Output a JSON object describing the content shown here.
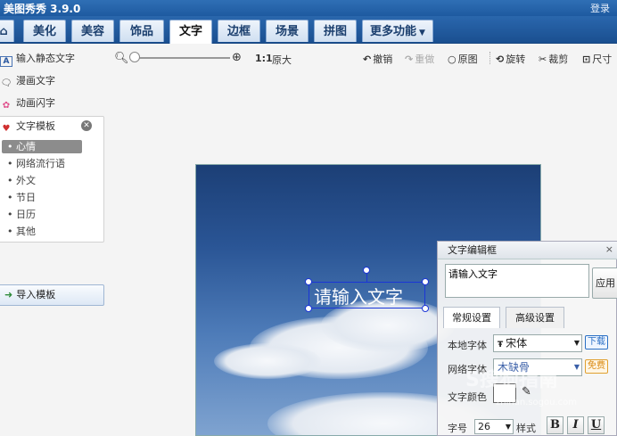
{
  "app": {
    "title": "美图秀秀 3.9.0",
    "login": "登录"
  },
  "tabs": [
    {
      "label": "美化"
    },
    {
      "label": "美容"
    },
    {
      "label": "饰品"
    },
    {
      "label": "文字"
    },
    {
      "label": "边框"
    },
    {
      "label": "场景"
    },
    {
      "label": "拼图"
    },
    {
      "label": "更多功能"
    }
  ],
  "active_tab": "文字",
  "toolbar": {
    "zoom_ratio": "1:1",
    "original_size": "原大",
    "undo": "撤销",
    "redo": "重做",
    "original": "原图",
    "rotate": "旋转",
    "crop": "裁剪",
    "resize": "尺寸"
  },
  "sidebar": {
    "items": [
      {
        "label": "输入静态文字",
        "icon": "A"
      },
      {
        "label": "漫画文字",
        "icon": "speech-icon"
      },
      {
        "label": "动画闪字",
        "icon": "flash-icon"
      }
    ],
    "template_header": "文字模板",
    "template_categories": [
      "心情",
      "网络流行语",
      "外文",
      "节日",
      "日历",
      "其他"
    ],
    "selected_category": "心情",
    "import_button": "导入模板"
  },
  "canvas": {
    "text": "请输入文字"
  },
  "dialog": {
    "title": "文字编辑框",
    "close": "×",
    "input_value": "请输入文字",
    "apply": "应用",
    "tab_basic": "常规设置",
    "tab_advanced": "高级设置",
    "local_font_label": "本地字体",
    "local_font_value": "宋体",
    "download_badge": "下载",
    "web_font_label": "网络字体",
    "web_font_value": "木缺骨",
    "free_badge": "免费",
    "color_label": "文字颜色",
    "size_label": "字号",
    "size_value": "26",
    "style_label": "样式",
    "bold": "B",
    "italic": "I",
    "underline": "U"
  },
  "watermark": {
    "main": "S搜狗指南",
    "sub": "zhinan.sogou.com"
  },
  "colors": {
    "titlebar": "#1e5aa0",
    "selection": "#1b36d6",
    "sky": "#2a5595"
  }
}
